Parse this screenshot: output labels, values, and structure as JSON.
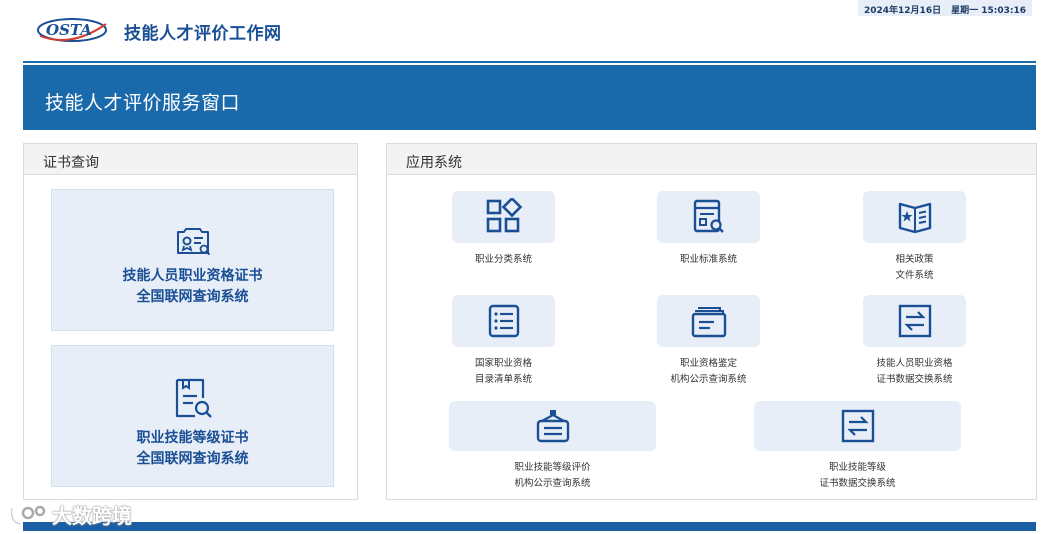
{
  "header": {
    "date": "2024年12月16日",
    "weekday_time": "星期一 15:03:16",
    "logo_text": "OSTA",
    "site_title": "技能人才评价工作网"
  },
  "banner": {
    "title": "技能人才评价服务窗口"
  },
  "cert_query": {
    "heading": "证书查询",
    "cards": [
      {
        "line1": "技能人员职业资格证书",
        "line2": "全国联网查询系统",
        "icon": "certificate-search-icon"
      },
      {
        "line1": "职业技能等级证书",
        "line2": "全国联网查询系统",
        "icon": "document-search-icon"
      }
    ]
  },
  "apps": {
    "heading": "应用系统",
    "items": [
      {
        "line1": "职业分类系统",
        "line2": "",
        "icon": "category-grid-icon"
      },
      {
        "line1": "职业标准系统",
        "line2": "",
        "icon": "standard-search-icon"
      },
      {
        "line1": "相关政策",
        "line2": "文件系统",
        "icon": "policy-book-icon"
      },
      {
        "line1": "国家职业资格",
        "line2": "目录清单系统",
        "icon": "list-icon"
      },
      {
        "line1": "职业资格鉴定",
        "line2": "机构公示查询系统",
        "icon": "documents-icon"
      },
      {
        "line1": "技能人员职业资格",
        "line2": "证书数据交换系统",
        "icon": "exchange-icon"
      },
      {
        "line1": "职业技能等级评价",
        "line2": "机构公示查询系统",
        "icon": "hanging-sign-icon"
      },
      {
        "line1": "职业技能等级",
        "line2": "证书数据交换系统",
        "icon": "exchange-icon"
      }
    ]
  },
  "watermark": {
    "text": "大数跨境"
  },
  "colors": {
    "brand_blue": "#1a6aab",
    "tile_bg": "#e8eef7",
    "title_blue": "#1a4f95"
  }
}
